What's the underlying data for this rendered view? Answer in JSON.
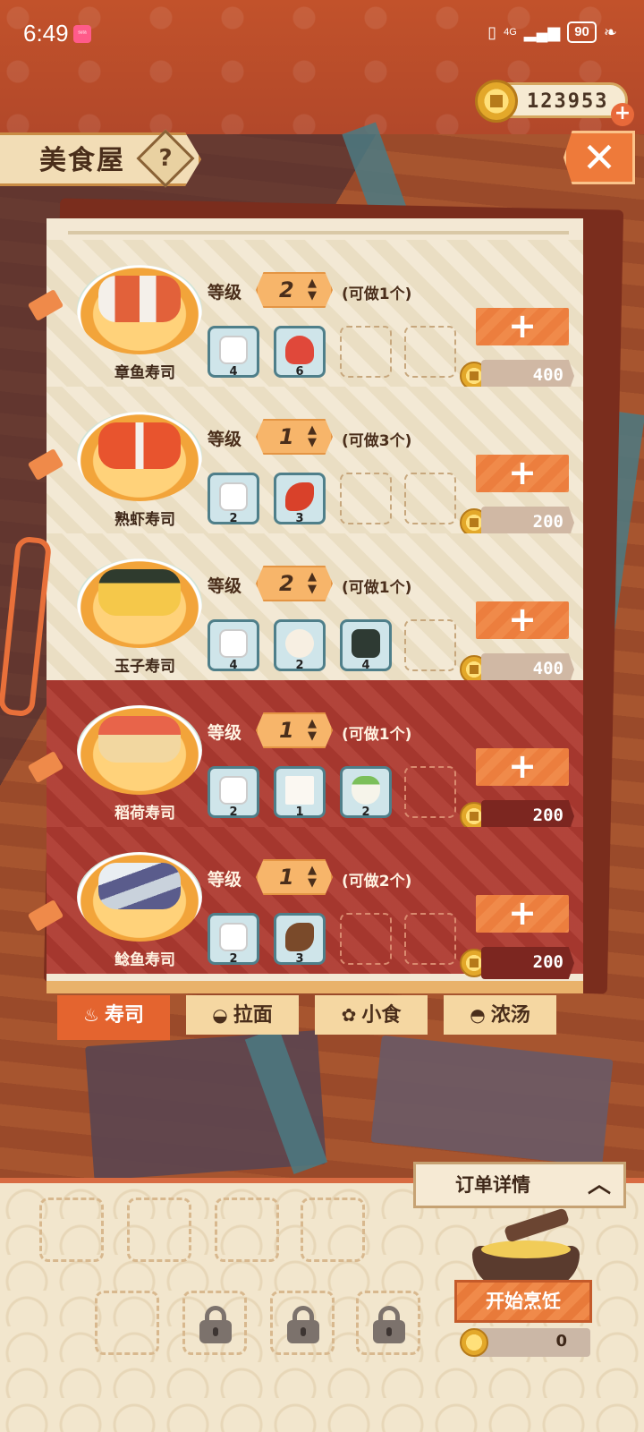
{
  "status_bar": {
    "time": "6:49",
    "app_badge": "ˢᵘᵗᵃ",
    "network": "4G",
    "battery": "90"
  },
  "currency": {
    "coins": "123953"
  },
  "title": {
    "text": "美食屋",
    "help": "?",
    "close": "✕"
  },
  "labels": {
    "grade": "等级"
  },
  "recipes": [
    {
      "name": "章鱼寿司",
      "grade": "2",
      "can_make": "(可做1个)",
      "price": "400",
      "ingredients": [
        {
          "icon": "rice-icon",
          "count": "4"
        },
        {
          "icon": "octopus-icon",
          "count": "6"
        }
      ]
    },
    {
      "name": "熟虾寿司",
      "grade": "1",
      "can_make": "(可做3个)",
      "price": "200",
      "ingredients": [
        {
          "icon": "rice-icon",
          "count": "2"
        },
        {
          "icon": "shrimp-icon",
          "count": "3"
        }
      ]
    },
    {
      "name": "玉子寿司",
      "grade": "2",
      "can_make": "(可做1个)",
      "price": "400",
      "ingredients": [
        {
          "icon": "rice-icon",
          "count": "4"
        },
        {
          "icon": "egg-icon",
          "count": "2"
        },
        {
          "icon": "seaweed-icon",
          "count": "4"
        }
      ]
    },
    {
      "name": "稻荷寿司",
      "grade": "1",
      "can_make": "(可做1个)",
      "price": "200",
      "ingredients": [
        {
          "icon": "rice-icon",
          "count": "2"
        },
        {
          "icon": "tofu-icon",
          "count": "1"
        },
        {
          "icon": "radish-icon",
          "count": "2"
        }
      ]
    },
    {
      "name": "鲶鱼寿司",
      "grade": "1",
      "can_make": "(可做2个)",
      "price": "200",
      "ingredients": [
        {
          "icon": "rice-icon",
          "count": "2"
        },
        {
          "icon": "catfish-icon",
          "count": "3"
        }
      ]
    }
  ],
  "tabs": [
    {
      "label": "寿司",
      "icon": "sushi-icon",
      "active": true
    },
    {
      "label": "拉面",
      "icon": "ramen-icon",
      "active": false
    },
    {
      "label": "小食",
      "icon": "snack-icon",
      "active": false
    },
    {
      "label": "浓汤",
      "icon": "soup-icon",
      "active": false
    }
  ],
  "tray": {
    "order_details": "订单详情",
    "start_cooking": "开始烹饪",
    "cost": "0"
  },
  "colors": {
    "accent": "#e4642f",
    "row_dark": "#ae3a30",
    "row_light": "#efe2c7",
    "ingredient_border": "#4f7f8a"
  }
}
